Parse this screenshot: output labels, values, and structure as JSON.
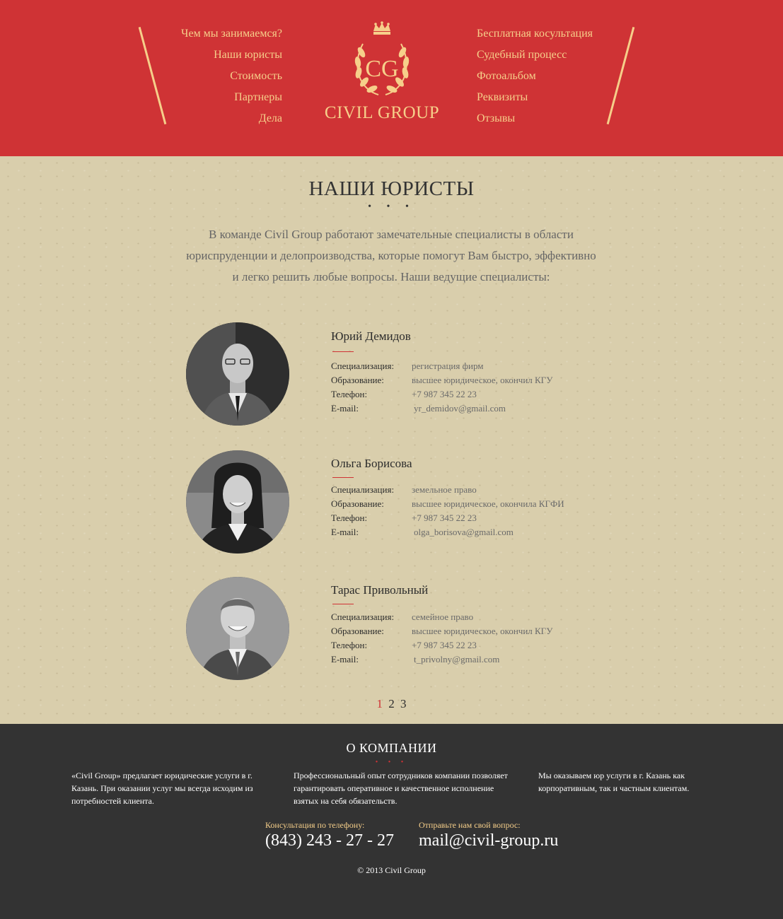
{
  "header": {
    "nav_left": [
      "Чем мы занимаемся?",
      "Наши юристы",
      "Стоимость",
      "Партнеры",
      "Дела"
    ],
    "nav_right": [
      "Бесплатная косультация",
      "Судебный процесс",
      "Фотоальбом",
      "Реквизиты",
      "Отзывы"
    ],
    "logo_monogram": "CG",
    "logo_text": "CIVIL GROUP"
  },
  "main": {
    "title": "НАШИ ЮРИСТЫ",
    "dots": "• • •",
    "intro": "В команде Civil Group работают замечательные специалисты в области юриспруденции и делопроизводства, которые помогут Вам быстро, эффективно и легко решить любые вопросы. Наши ведущие специалисты:",
    "labels": {
      "specialization": "Специализация:",
      "education": "Образование:",
      "phone": "Телефон:",
      "email": "E-mail:"
    },
    "lawyers": [
      {
        "name": "Юрий Демидов",
        "specialization": "регистрация фирм",
        "education": "высшее юридическое, окончил КГУ",
        "phone": "+7 987 345 22 23",
        "email": "yr_demidov@gmail.com"
      },
      {
        "name": "Ольга Борисова",
        "specialization": "земельное право",
        "education": "высшее юридическое, окончила КГФИ",
        "phone": "+7 987 345 22 23",
        "email": "olga_borisova@gmail.com"
      },
      {
        "name": "Тарас Привольный",
        "specialization": "семейное право",
        "education": "высшее юридическое, окончил КГУ",
        "phone": "+7 987 345 22 23",
        "email": "t_privolny@gmail.com"
      }
    ],
    "pages": [
      "1",
      "2",
      "3"
    ],
    "current_page": "1"
  },
  "footer": {
    "title": "О КОМПАНИИ",
    "dots": "• • •",
    "col1": "«Civil Group» предлагает юридические услуги в г. Казань. При оказании услуг мы всегда исходим из потребностей клиента.",
    "col2": "Профессиональный опыт сотрудников  компании позволяет гарантировать оперативное и качественное исполнение взятых на себя обязательств.",
    "col3": "Мы оказываем юр услуги в г. Казань как корпоративным, так и частным клиентам.",
    "phone_label": "Консультация по телефону:",
    "phone": "(843) 243 - 27 - 27",
    "email_label": "Отправьте нам свой вопрос:",
    "email": "mail@civil-group.ru",
    "copyright": "© 2013 Civil Group"
  },
  "colors": {
    "header_bg": "#cf3335",
    "accent_gold": "#f6cf8a",
    "paper_bg": "#d9ceac",
    "footer_bg": "#333333"
  }
}
